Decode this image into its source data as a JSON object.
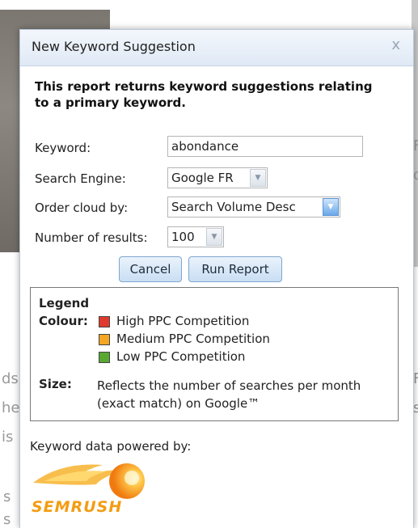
{
  "dialog": {
    "title": "New Keyword Suggestion",
    "close_glyph": "x",
    "intro": "This report returns keyword suggestions relating to a primary keyword.",
    "fields": {
      "keyword_label": "Keyword:",
      "keyword_value": "abondance",
      "engine_label": "Search Engine:",
      "engine_value": "Google FR",
      "order_label": "Order cloud by:",
      "order_value": "Search Volume Desc",
      "results_label": "Number of results:",
      "results_value": "100"
    },
    "buttons": {
      "cancel": "Cancel",
      "run": "Run Report"
    },
    "legend": {
      "title": "Legend",
      "colour_label": "Colour:",
      "items": [
        {
          "label": "High PPC Competition",
          "color": "#e03a2e"
        },
        {
          "label": "Medium PPC Competition",
          "color": "#f5a623"
        },
        {
          "label": "Low PPC Competition",
          "color": "#58a832"
        }
      ],
      "size_label": "Size:",
      "size_text": "Reflects the number of searches per month (exact match) on Google™"
    },
    "powered_by": "Keyword data powered by:",
    "logo_text": "SEMRUSH",
    "accent": "#f39c12"
  },
  "background": {
    "fragments": [
      "ds",
      "he",
      "is",
      "s",
      "s",
      "F",
      "ol",
      "F",
      "s"
    ]
  }
}
